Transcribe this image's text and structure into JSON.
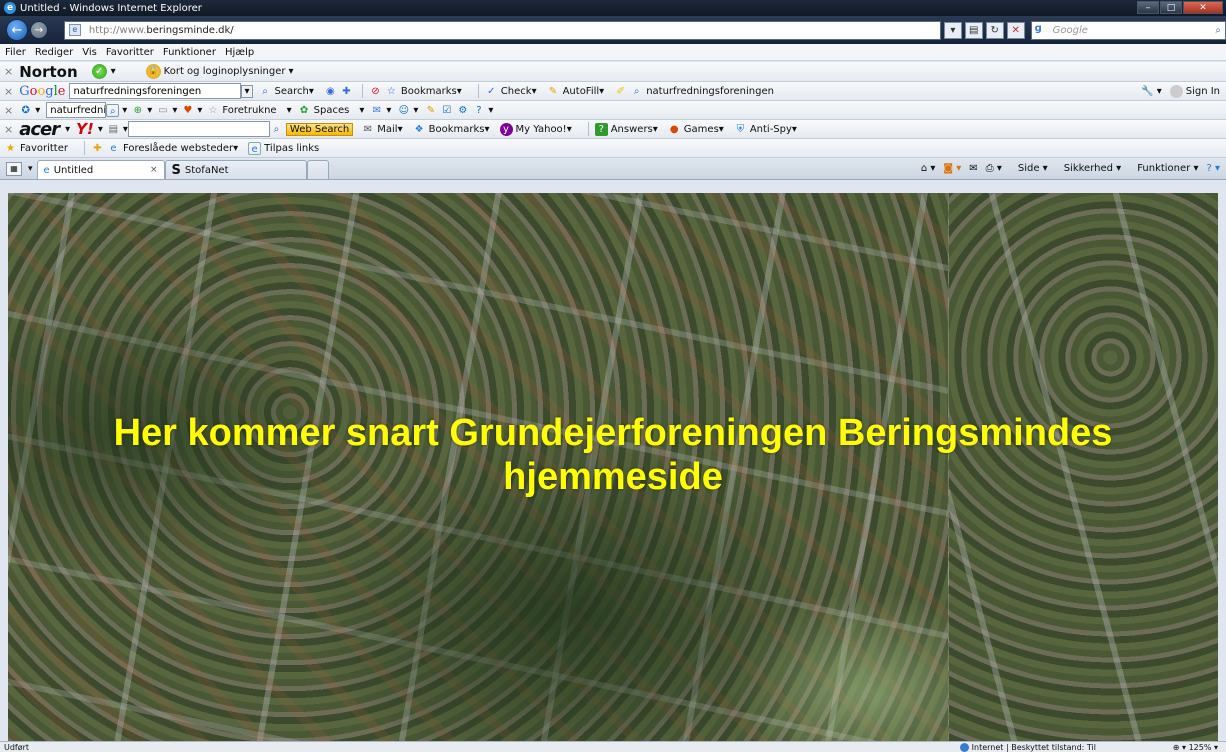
{
  "window": {
    "title": "Untitled - Windows Internet Explorer"
  },
  "address": {
    "prefix": "http://www.",
    "domain": "beringsminde.dk/"
  },
  "search": {
    "placeholder": "Google"
  },
  "menu": [
    "Filer",
    "Rediger",
    "Vis",
    "Favoritter",
    "Funktioner",
    "Hjælp"
  ],
  "norton": {
    "brand": "Norton",
    "login_label": "Kort og loginoplysninger"
  },
  "google_toolbar": {
    "query": "naturfredningsforeningen",
    "search_label": "Search",
    "bookmarks_label": "Bookmarks",
    "check_label": "Check",
    "autofill_label": "AutoFill",
    "highlight_term": "naturfredningsforeningen",
    "sign_in_label": "Sign In"
  },
  "aol_toolbar": {
    "query": "naturfrednin",
    "foretrukne_label": "Foretrukne",
    "spaces_label": "Spaces"
  },
  "yahoo_toolbar": {
    "web_search_label": "Web Search",
    "mail_label": "Mail",
    "bookmarks_label": "Bookmarks",
    "my_yahoo_label": "My Yahoo!",
    "answers_label": "Answers",
    "games_label": "Games",
    "antispy_label": "Anti-Spy"
  },
  "favorites_bar": {
    "favorites_label": "Favoritter",
    "suggested_label": "Foreslåede websteder",
    "customize_label": "Tilpas links"
  },
  "tabs": [
    {
      "label": "Untitled"
    },
    {
      "label": "StofaNet"
    }
  ],
  "command_bar": {
    "page_label": "Side",
    "safety_label": "Sikkerhed",
    "tools_label": "Funktioner"
  },
  "content": {
    "headline": "Her kommer snart Grundejerforeningen Beringsmindes hjemmeside"
  },
  "status": {
    "text": "Udført",
    "zone": "Internet | Beskyttet tilstand: Til",
    "zoom": "125%"
  }
}
